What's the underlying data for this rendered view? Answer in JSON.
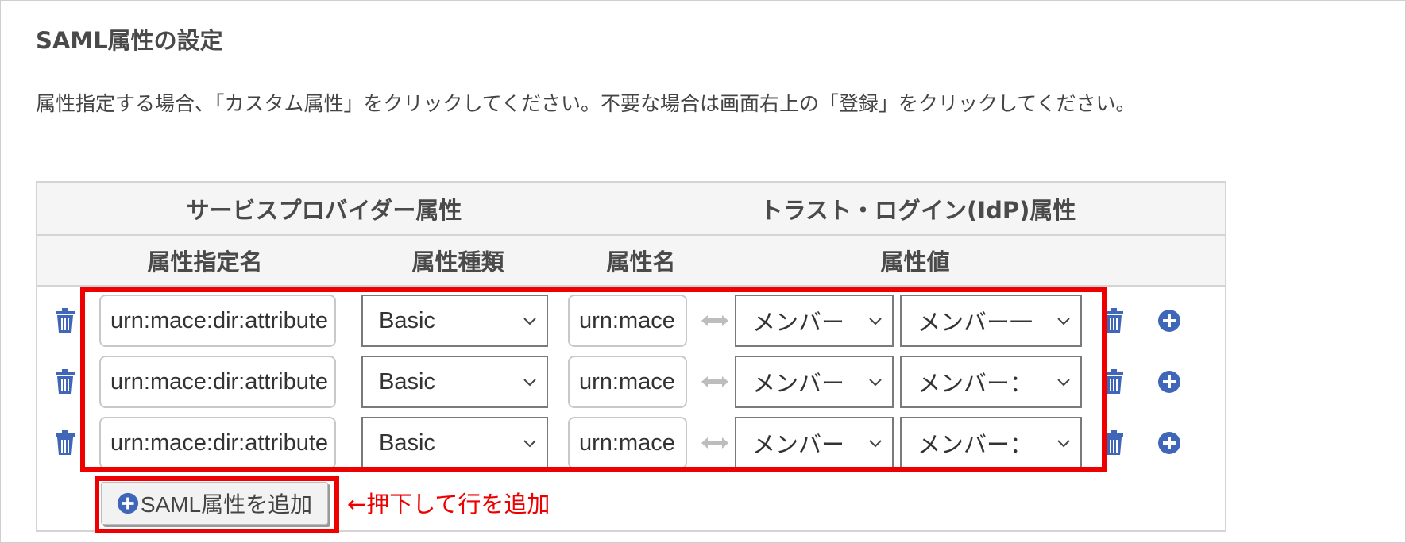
{
  "section": {
    "title": "SAML属性の設定",
    "description": "属性指定する場合、「カスタム属性」をクリックしてください。不要な場合は画面右上の「登録」をクリックしてください。"
  },
  "table": {
    "group_headers": {
      "service_provider": "サービスプロバイダー属性",
      "idp": "トラスト・ログイン(IdP)属性"
    },
    "column_headers": {
      "attr_spec_name": "属性指定名",
      "attr_type": "属性種類",
      "attr_name": "属性名",
      "attr_value": "属性値"
    },
    "rows": [
      {
        "spec_name": "urn:mace:dir:attribute",
        "type": "Basic",
        "name": "urn:mace",
        "source": "メンバー",
        "value": "メンバー一"
      },
      {
        "spec_name": "urn:mace:dir:attribute",
        "type": "Basic",
        "name": "urn:mace",
        "source": "メンバー",
        "value": "メンバー："
      },
      {
        "spec_name": "urn:mace:dir:attribute",
        "type": "Basic",
        "name": "urn:mace",
        "source": "メンバー",
        "value": "メンバー："
      }
    ]
  },
  "add_button": {
    "label": "SAML属性を追加"
  },
  "annotation": {
    "text": "←押下して行を追加"
  },
  "colors": {
    "accent_blue": "#3f66b8",
    "annotation_red": "#ee0000"
  },
  "icons": {
    "delete": "trash-icon",
    "add_row": "plus-circle-icon",
    "map": "double-arrow-icon",
    "dropdown": "chevron-down-icon"
  }
}
